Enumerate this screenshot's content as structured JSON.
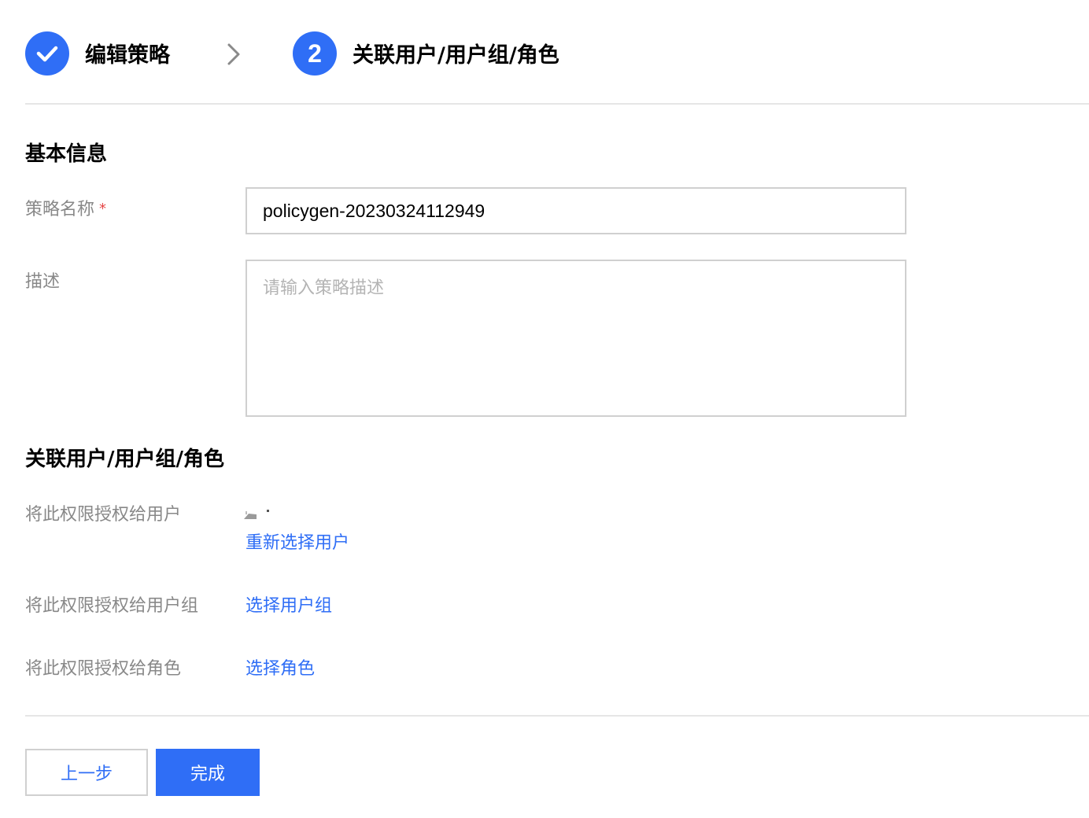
{
  "steps": [
    {
      "label": "编辑策略",
      "status": "done"
    },
    {
      "number": "2",
      "label": "关联用户/用户组/角色",
      "status": "active"
    }
  ],
  "basic_info": {
    "title": "基本信息",
    "policy_name_label": "策略名称",
    "required_mark": "*",
    "policy_name_value": "policygen-20230324112949",
    "description_label": "描述",
    "description_placeholder": "请输入策略描述"
  },
  "association": {
    "title": "关联用户/用户组/角色",
    "user_label": "将此权限授权给用户",
    "reselect_user_link": "重新选择用户",
    "group_label": "将此权限授权给用户组",
    "select_group_link": "选择用户组",
    "role_label": "将此权限授权给角色",
    "select_role_link": "选择角色"
  },
  "footer": {
    "prev_label": "上一步",
    "finish_label": "完成"
  },
  "colors": {
    "accent": "#2f6ef6",
    "label_gray": "#888888",
    "border": "#d0d0d0",
    "required": "#e54545"
  }
}
